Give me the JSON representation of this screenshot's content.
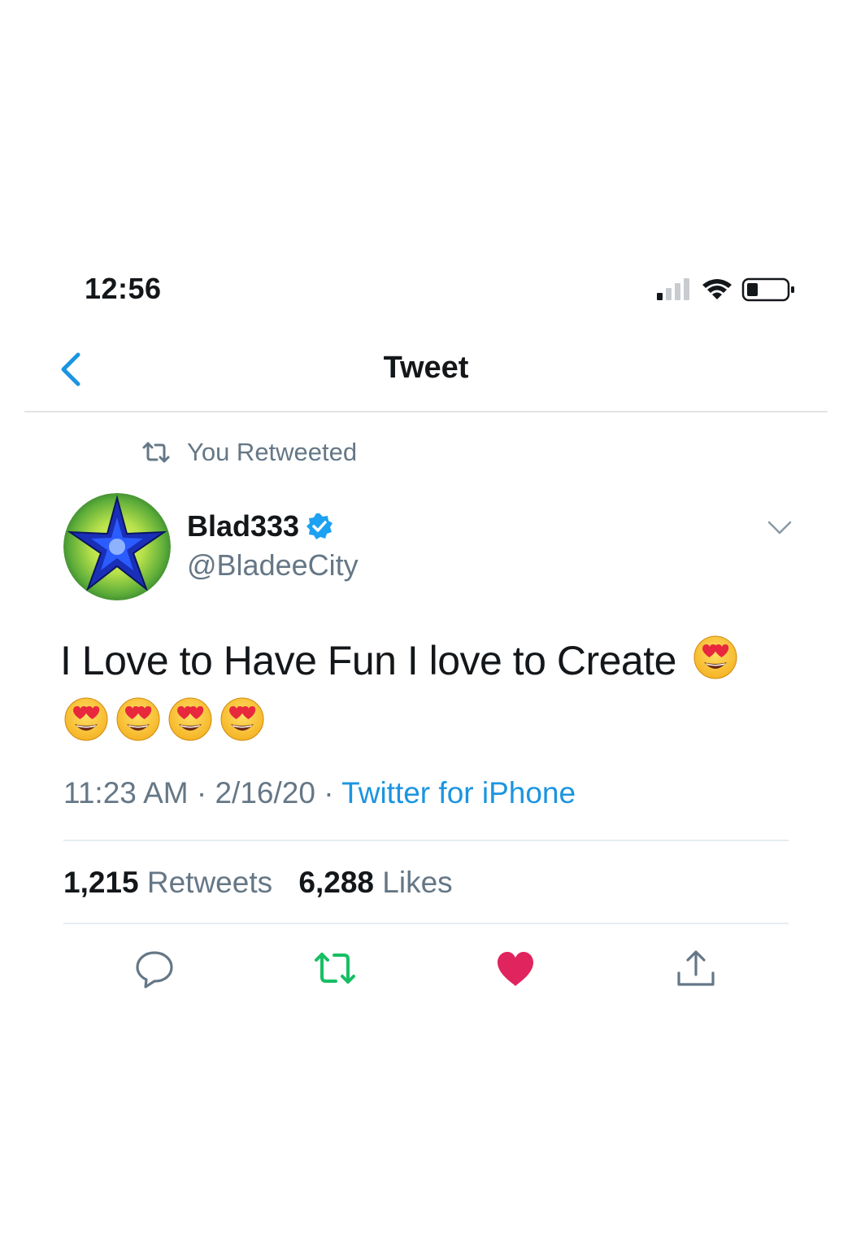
{
  "status_bar": {
    "time": "12:56",
    "icons": [
      "signal-icon",
      "wifi-icon",
      "battery-icon"
    ]
  },
  "header": {
    "title": "Tweet",
    "back_icon": "chevron-left-icon"
  },
  "retweet_context": {
    "label": "You Retweeted",
    "icon": "retweet-icon"
  },
  "author": {
    "name": "Blad333",
    "handle": "@BladeeCity",
    "verified": true,
    "avatar_icon": "star-avatar"
  },
  "tweet": {
    "text": "I Love to Have Fun I love to Create",
    "emoji_count": 5,
    "emoji": "heart-eyes-emoji"
  },
  "meta": {
    "time": "11:23 AM",
    "separator": "·",
    "date": "2/16/20",
    "source": "Twitter for iPhone"
  },
  "stats": {
    "retweets_count": "1,215",
    "retweets_label": "Retweets",
    "likes_count": "6,288",
    "likes_label": "Likes"
  },
  "actions": {
    "reply_icon": "reply-icon",
    "retweet_icon": "retweet-icon",
    "like_icon": "heart-icon",
    "share_icon": "share-icon",
    "retweet_active_color": "#17bf63",
    "like_active_color": "#e0245e"
  },
  "colors": {
    "accent": "#1b95e0",
    "secondary_text": "#657786",
    "primary_text": "#14171a"
  }
}
